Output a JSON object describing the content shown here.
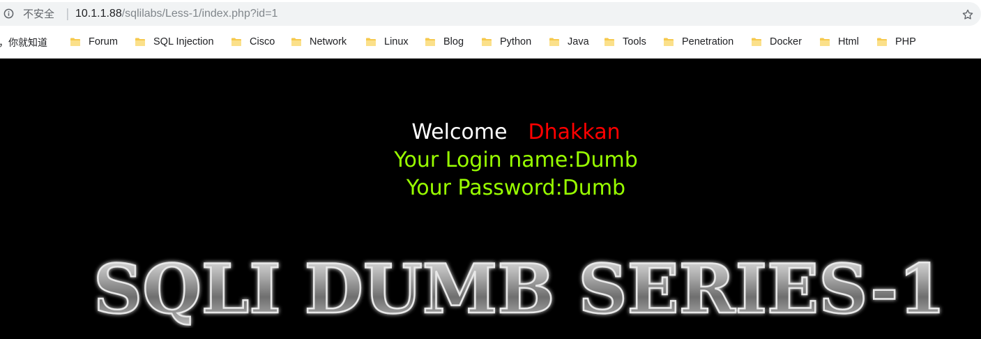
{
  "browser": {
    "security_label": "不安全",
    "url_host": "10.1.1.88",
    "url_path": "/sqlilabs/Less-1/index.php?id=1",
    "bookmarks_lead": "，你就知道",
    "bookmarks": [
      {
        "label": "Forum"
      },
      {
        "label": "SQL Injection"
      },
      {
        "label": "Cisco"
      },
      {
        "label": "Network"
      },
      {
        "label": "Linux"
      },
      {
        "label": "Blog"
      },
      {
        "label": "Python"
      },
      {
        "label": "Java"
      },
      {
        "label": "Tools"
      },
      {
        "label": "Penetration"
      },
      {
        "label": "Docker"
      },
      {
        "label": "Html"
      },
      {
        "label": "PHP"
      }
    ]
  },
  "page": {
    "welcome": "Welcome",
    "user_display": "Dhakkan",
    "login_line": "Your Login name:Dumb",
    "password_line": "Your Password:Dumb",
    "banner_text": "SQLI DUMB SERIES-1"
  },
  "colors": {
    "background": "#000000",
    "welcome": "#ffffff",
    "user_display": "#ff0000",
    "credentials": "#99ff00"
  }
}
